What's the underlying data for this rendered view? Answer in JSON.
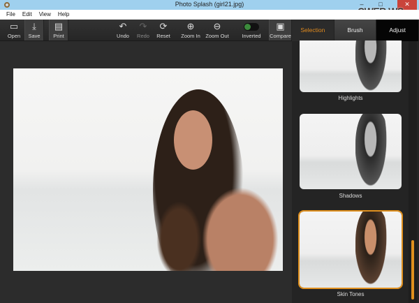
{
  "window": {
    "title": "Photo Splash (girl21.jpg)",
    "minimize": "–",
    "maximize": "□",
    "close": "✕",
    "watermark": "CWER.WS"
  },
  "menu": [
    "File",
    "Edit",
    "View",
    "Help"
  ],
  "toolbar": {
    "open": {
      "label": "Open",
      "icon": "image-icon"
    },
    "save": {
      "label": "Save",
      "icon": "download-icon"
    },
    "print": {
      "label": "Print",
      "icon": "printer-icon"
    },
    "undo": {
      "label": "Undo",
      "icon": "undo-icon"
    },
    "redo": {
      "label": "Redo",
      "icon": "redo-icon",
      "disabled": true
    },
    "reset": {
      "label": "Reset",
      "icon": "refresh-icon"
    },
    "zoom_in": {
      "label": "Zoom In",
      "icon": "zoom-in-icon"
    },
    "zoom_out": {
      "label": "Zoom Out",
      "icon": "zoom-out-icon"
    },
    "inverted": {
      "label": "Inverted",
      "on": false
    },
    "compare": {
      "label": "Compare",
      "icon": "compare-icon"
    }
  },
  "panel": {
    "tabs": [
      {
        "label": "Selection",
        "active": true
      },
      {
        "label": "Brush"
      },
      {
        "label": "Adjust"
      }
    ],
    "presets": [
      {
        "label": "Highlights"
      },
      {
        "label": "Shadows"
      },
      {
        "label": "Skin Tones",
        "selected": true
      }
    ]
  },
  "colors": {
    "accent": "#e08a1e",
    "toolbar": "#2b2b2b",
    "titlebar": "#9fd0ee"
  }
}
